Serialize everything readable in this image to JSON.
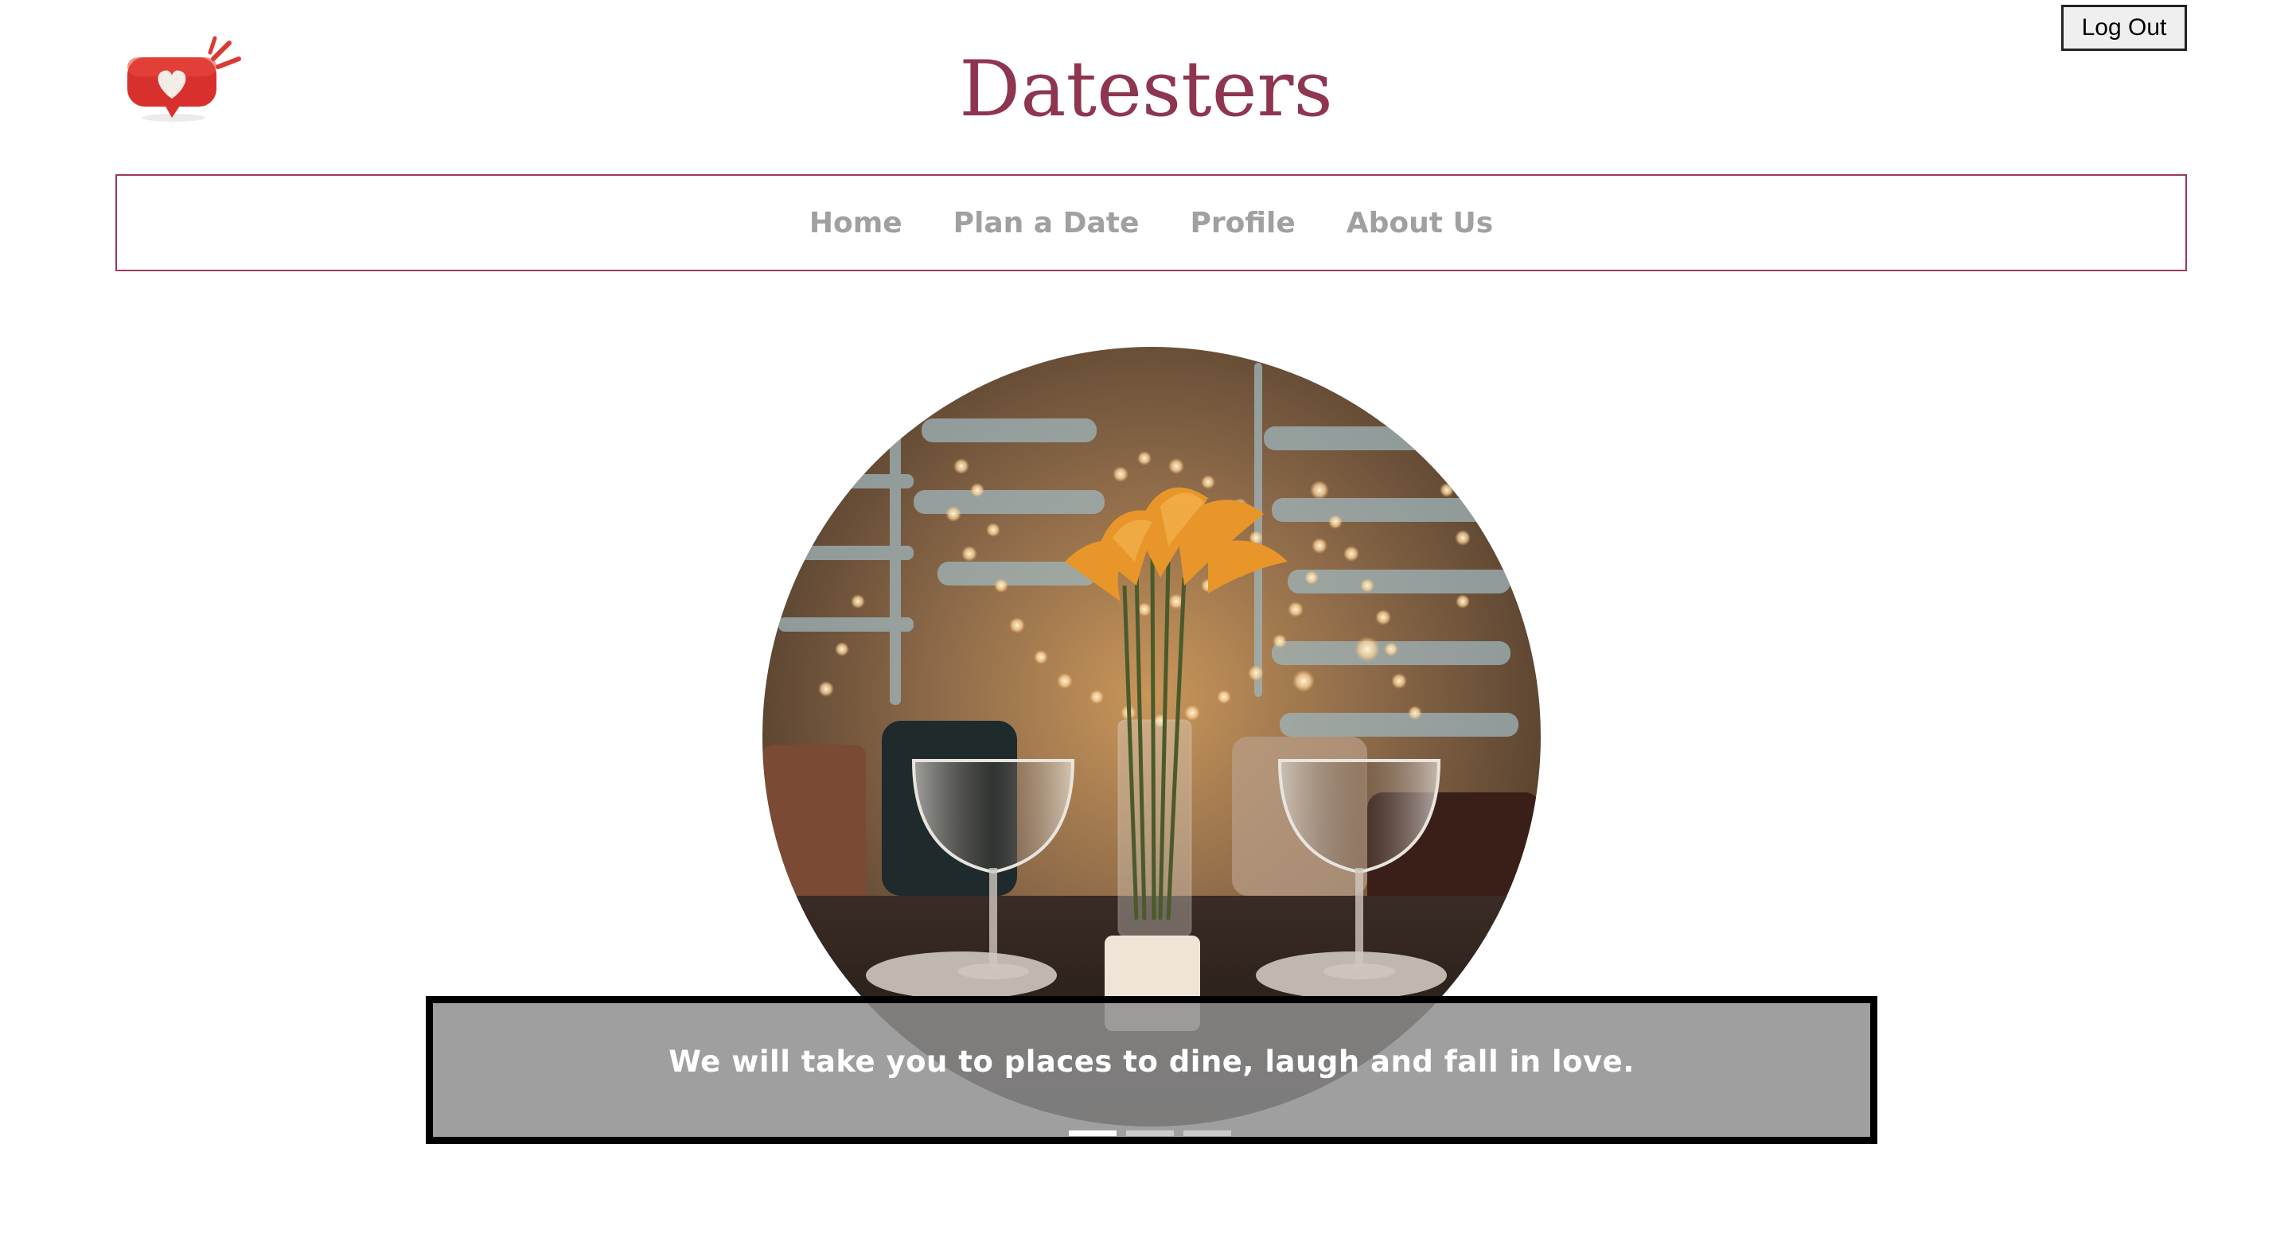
{
  "header": {
    "title": "Datesters",
    "logout_label": "Log Out",
    "logo_icon": "heart-speech-bubble-icon"
  },
  "nav": {
    "items": [
      {
        "label": "Home"
      },
      {
        "label": "Plan a Date"
      },
      {
        "label": "Profile"
      },
      {
        "label": "About Us"
      }
    ]
  },
  "hero": {
    "caption": "We will take you to places to dine, laugh and fall in love.",
    "slide_count": 3,
    "active_slide": 1
  },
  "colors": {
    "brand": "#8e3550",
    "nav_border": "#9e3a5a",
    "nav_text": "#a0a0a0"
  }
}
